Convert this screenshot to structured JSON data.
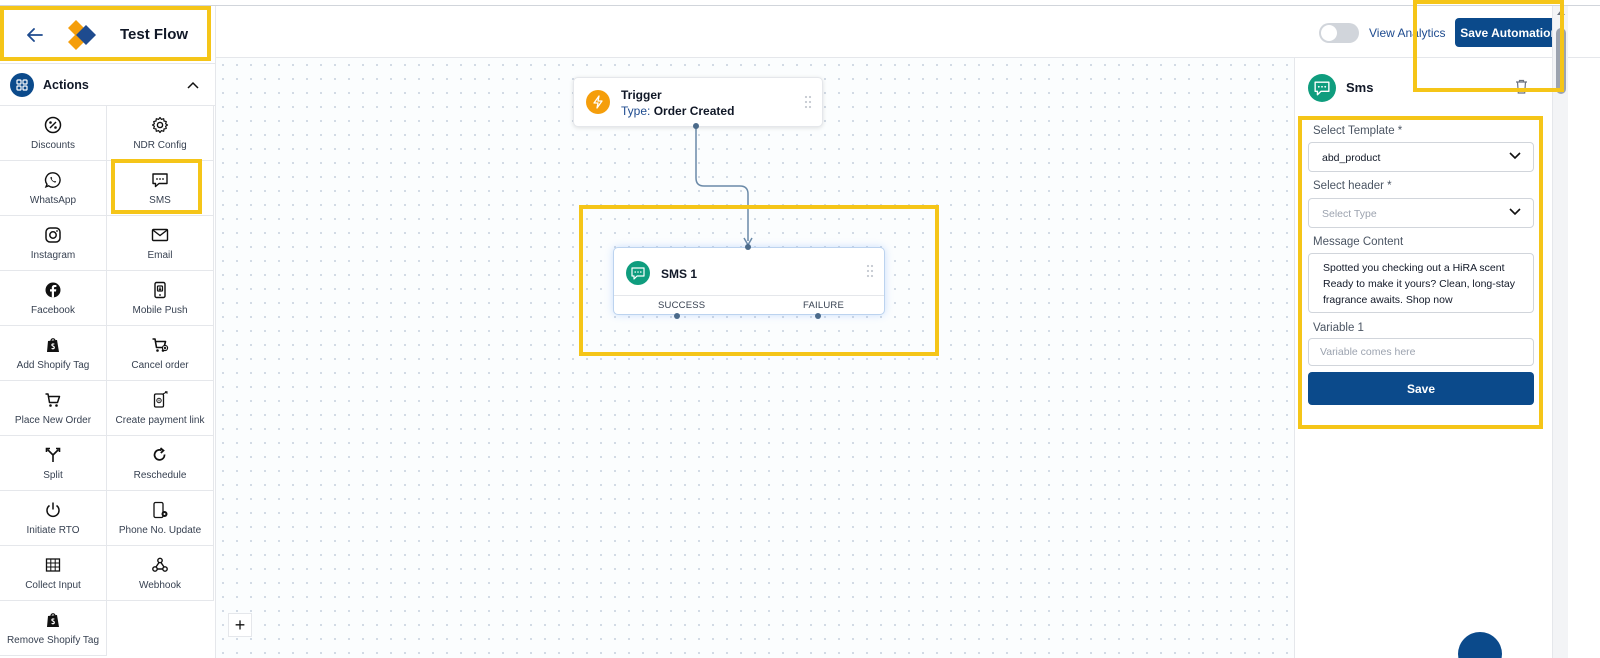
{
  "header": {
    "flow_title": "Test Flow",
    "view_analytics_label": "View Analytics",
    "save_automation_label": "Save Automation"
  },
  "sidebar": {
    "section_title": "Actions",
    "items": [
      {
        "label": "Discounts",
        "icon": "percent-icon"
      },
      {
        "label": "NDR Config",
        "icon": "gear-icon"
      },
      {
        "label": "WhatsApp",
        "icon": "whatsapp-icon"
      },
      {
        "label": "SMS",
        "icon": "sms-icon"
      },
      {
        "label": "Instagram",
        "icon": "instagram-icon"
      },
      {
        "label": "Email",
        "icon": "mail-icon"
      },
      {
        "label": "Facebook",
        "icon": "facebook-icon"
      },
      {
        "label": "Mobile Push",
        "icon": "mobile-push-icon"
      },
      {
        "label": "Add Shopify Tag",
        "icon": "shopify-icon"
      },
      {
        "label": "Cancel order",
        "icon": "cart-cancel-icon"
      },
      {
        "label": "Place New Order",
        "icon": "cart-icon"
      },
      {
        "label": "Create payment link",
        "icon": "payment-link-icon"
      },
      {
        "label": "Split",
        "icon": "split-icon"
      },
      {
        "label": "Reschedule",
        "icon": "redo-icon"
      },
      {
        "label": "Initiate RTO",
        "icon": "power-icon"
      },
      {
        "label": "Phone No. Update",
        "icon": "phone-settings-icon"
      },
      {
        "label": "Collect Input",
        "icon": "columns-icon"
      },
      {
        "label": "Webhook",
        "icon": "webhook-icon"
      },
      {
        "label": "Remove Shopify Tag",
        "icon": "shopify-icon"
      }
    ]
  },
  "canvas": {
    "trigger": {
      "title": "Trigger",
      "type_label": "Type:",
      "type_value": "Order Created"
    },
    "sms_node": {
      "title": "SMS 1",
      "success_label": "SUCCESS",
      "failure_label": "FAILURE"
    },
    "zoom_in_label": "+"
  },
  "panel": {
    "title": "Sms",
    "template_label": "Select Template *",
    "template_value": "abd_product",
    "header_label": "Select header *",
    "header_placeholder": "Select Type",
    "message_label": "Message Content",
    "message_value": "Spotted you checking out a HiRA scent Ready to make it yours? Clean, long-stay fragrance awaits. Shop now",
    "variable_label": "Variable 1",
    "variable_placeholder": "Variable comes here",
    "save_label": "Save"
  },
  "colors": {
    "primary": "#0b4a8b",
    "accent_teal": "#0f9d7e",
    "trigger_orange": "#f59e0b",
    "highlight_yellow": "#f5c518"
  }
}
